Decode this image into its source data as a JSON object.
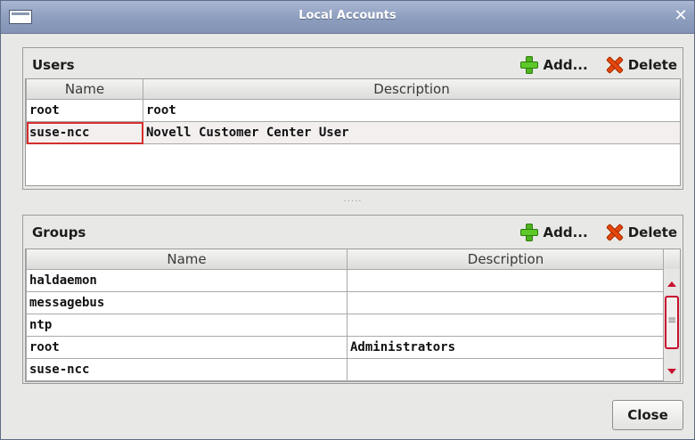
{
  "window": {
    "title": "Local Accounts",
    "close_glyph": "✕"
  },
  "users": {
    "title": "Users",
    "add_label": "Add...",
    "delete_label": "Delete",
    "columns": [
      "Name",
      "Description"
    ],
    "rows": [
      {
        "name": "root",
        "description": "root"
      },
      {
        "name": "suse-ncc",
        "description": "Novell Customer Center User"
      }
    ],
    "selected_row": 1
  },
  "splitter": {
    "grip": "....."
  },
  "groups": {
    "title": "Groups",
    "add_label": "Add...",
    "delete_label": "Delete",
    "columns": [
      "Name",
      "Description"
    ],
    "rows": [
      {
        "name": "haldaemon",
        "description": ""
      },
      {
        "name": "messagebus",
        "description": ""
      },
      {
        "name": "ntp",
        "description": ""
      },
      {
        "name": "root",
        "description": "Administrators"
      },
      {
        "name": "suse-ncc",
        "description": ""
      }
    ]
  },
  "footer": {
    "close_label": "Close"
  },
  "icons": {
    "add": "plus-icon",
    "delete": "delete-x-icon",
    "window": "window-icon",
    "scroll_up": "arrow-up-icon",
    "scroll_down": "arrow-down-icon"
  },
  "colors": {
    "titlebar": "#8f9fbf",
    "selection_outline": "#d62e2e",
    "add_green": "#4fb41f",
    "delete_orange": "#e8460c"
  }
}
